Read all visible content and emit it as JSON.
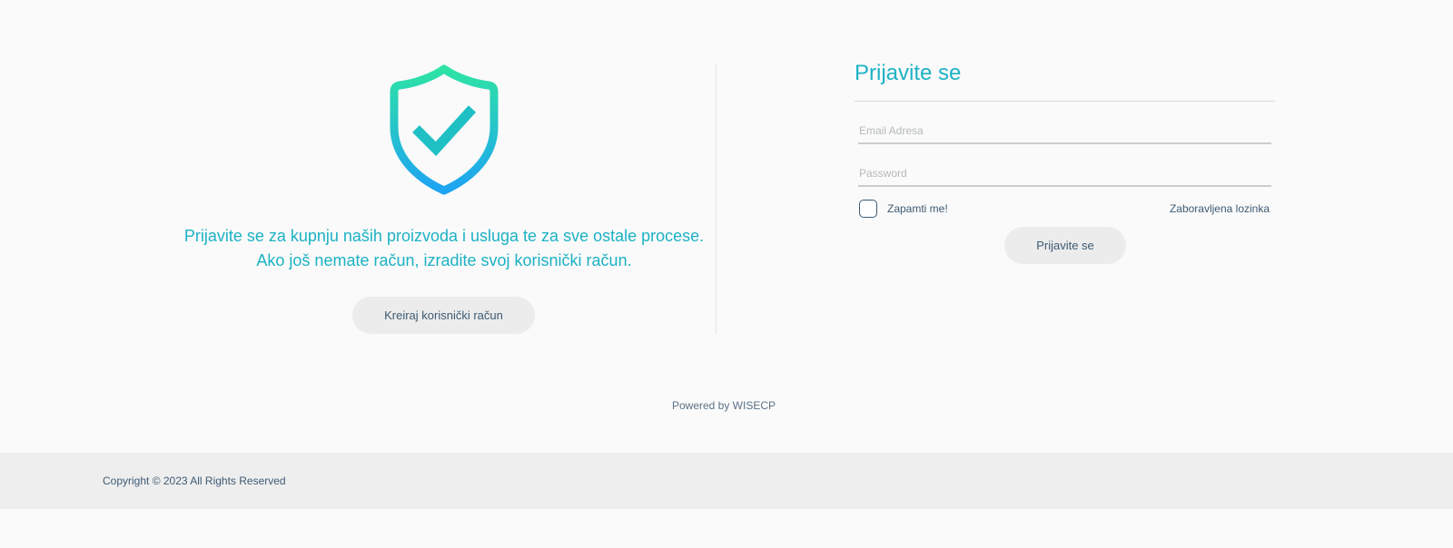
{
  "intro": {
    "text": "Prijavite se za kupnju naših proizvoda i usluga te za sve ostale procese. Ako još nemate račun, izradite svoj korisnički račun.",
    "create_account_label": "Kreiraj korisnički račun",
    "icon": "shield-check-icon",
    "gradient_top": "#2de3a5",
    "gradient_bottom": "#1ea4f2",
    "check_color": "#1cb2c4"
  },
  "login": {
    "title": "Prijavite se",
    "email_placeholder": "Email Adresa",
    "password_placeholder": "Password",
    "remember_label": "Zapamti me!",
    "forgot_label": "Zaboravljena lozinka",
    "submit_label": "Prijavite se"
  },
  "powered": {
    "prefix": "Powered by ",
    "brand": "WISECP"
  },
  "footer": {
    "copyright": "Copyright © 2023 All Rights Reserved"
  },
  "colors": {
    "accent": "#1cb2c4",
    "text_dark": "#3d5a73",
    "background": "#fafafa",
    "button_bg": "#ececec",
    "footer_bg": "#eeeeee"
  }
}
